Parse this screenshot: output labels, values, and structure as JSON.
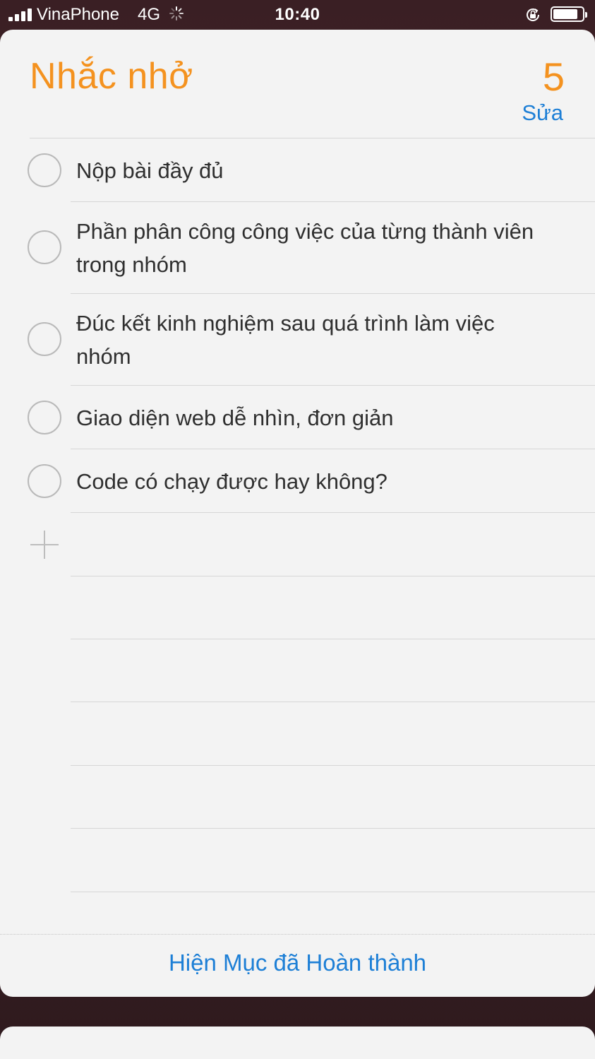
{
  "status_bar": {
    "carrier": "VinaPhone",
    "network": "4G",
    "time": "10:40"
  },
  "header": {
    "title": "Nhắc nhở",
    "count": "5",
    "edit_label": "Sửa"
  },
  "reminders": [
    {
      "text": "Nộp bài đầy đủ"
    },
    {
      "text": "Phần phân công công việc của từng thành viên trong nhóm"
    },
    {
      "text": "Đúc kết kinh nghiệm sau quá trình làm việc nhóm"
    },
    {
      "text": "Giao diện web dễ nhìn, đơn giản"
    },
    {
      "text": "Code có chạy được hay không?"
    }
  ],
  "footer": {
    "show_completed_label": "Hiện Mục đã Hoàn thành"
  },
  "colors": {
    "accent_orange": "#f4921f",
    "link_blue": "#1d7fd6"
  }
}
